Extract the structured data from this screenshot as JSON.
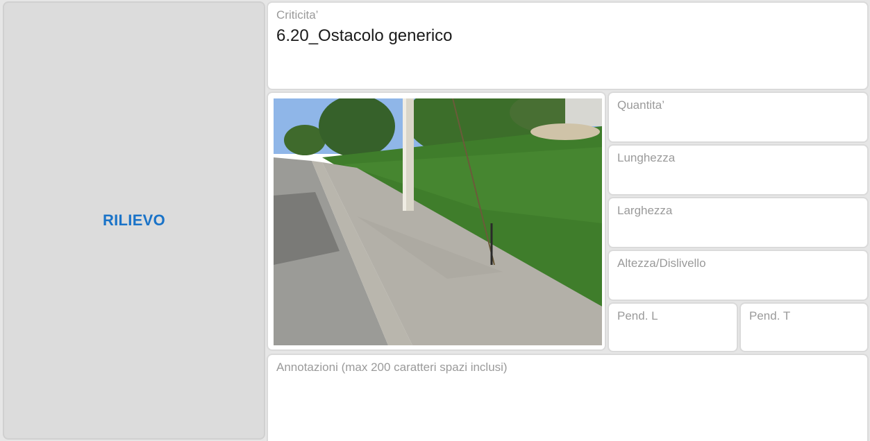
{
  "sidebar": {
    "title": "RILIEVO"
  },
  "criticita": {
    "label": "Criticita’",
    "value": "6.20_Ostacolo generico"
  },
  "fields": {
    "quantita": "Quantita’",
    "lunghezza": "Lunghezza",
    "larghezza": "Larghezza",
    "altezza": "Altezza/Dislivello",
    "pend_l": "Pend. L",
    "pend_t": "Pend. T"
  },
  "annotazioni": {
    "label": "Annotazioni (max 200 caratteri spazi inclusi)"
  },
  "colors": {
    "accent": "#1a73c8",
    "label": "#9a9a9a",
    "sidebar_bg": "#dcdcdc"
  }
}
